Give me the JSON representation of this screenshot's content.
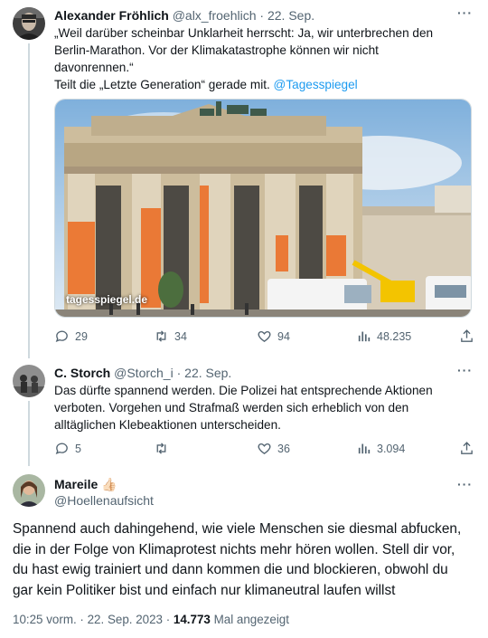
{
  "tweet1": {
    "name": "Alexander Fröhlich",
    "handle": "@alx_froehlich",
    "date": "22. Sep.",
    "lines": [
      "„Weil darüber scheinbar Unklarheit herrscht: Ja, wir unterbrechen den",
      "Berlin-Marathon. Vor der Klimakatastrophe können wir nicht",
      "davonrennen.“"
    ],
    "line4_prefix": "Teilt die „Letzte Generation“ gerade mit. ",
    "mention": "@Tagesspiegel",
    "media_label": "tagesspiegel.de",
    "replies": "29",
    "retweets": "34",
    "likes": "94",
    "views": "48.235"
  },
  "tweet2": {
    "name": "C. Storch",
    "handle": "@Storch_i",
    "date": "22. Sep.",
    "lines": [
      "Das dürfte spannend werden. Die Polizei hat entsprechende Aktionen",
      "verboten. Vorgehen und Strafmaß werden sich erheblich von den",
      "alltäglichen Klebeaktionen unterscheiden."
    ],
    "replies": "5",
    "retweets": "",
    "likes": "36",
    "views": "3.094"
  },
  "tweet3": {
    "name": "Mareile",
    "name_emoji": "👍🏻",
    "handle": "@Hoellenaufsicht",
    "lines": [
      "Spannend auch dahingehend, wie viele Menschen sie diesmal abfucken,",
      "die in der Folge von Klimaprotest nichts mehr hören wollen. Stell dir vor,",
      "du hast ewig trainiert und dann kommen die und blockieren, obwohl du",
      "gar kein Politiker bist und einfach nur klimaneutral laufen willst"
    ],
    "timestamp": "10:25 vorm. · 22. Sep. 2023 · ",
    "views_count": "14.773",
    "views_label": " Mal angezeigt"
  },
  "colors": {
    "accent": "#1d9bf0",
    "text": "#0f1419",
    "muted": "#536471",
    "thread_line": "#cfd9de"
  },
  "icons": {
    "reply": "speech-bubble-icon",
    "retweet": "retweet-arrows-icon",
    "like": "heart-icon",
    "views": "bar-chart-icon",
    "share": "share-upload-icon",
    "more": "ellipsis-icon"
  }
}
